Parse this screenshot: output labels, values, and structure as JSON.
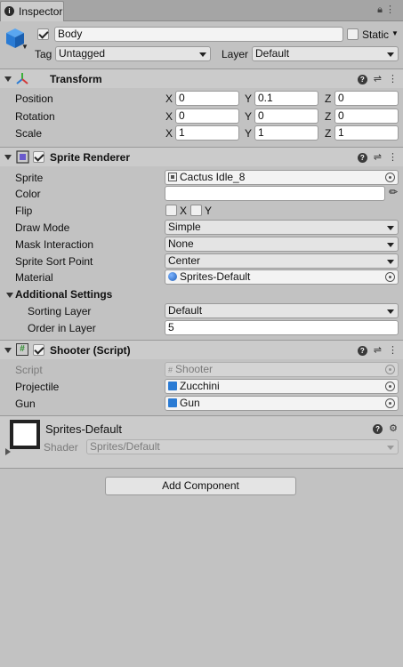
{
  "tab": {
    "title": "Inspector",
    "lock_icon": "lock-icon",
    "menu_icon": "kebab-icon"
  },
  "gameobject": {
    "name": "Body",
    "active": true,
    "static_label": "Static",
    "static": false,
    "tag_label": "Tag",
    "tag_value": "Untagged",
    "layer_label": "Layer",
    "layer_value": "Default"
  },
  "transform": {
    "title": "Transform",
    "rows": [
      {
        "label": "Position",
        "x": "0",
        "y": "0.1",
        "z": "0"
      },
      {
        "label": "Rotation",
        "x": "0",
        "y": "0",
        "z": "0"
      },
      {
        "label": "Scale",
        "x": "1",
        "y": "1",
        "z": "1"
      }
    ],
    "axis": {
      "x": "X",
      "y": "Y",
      "z": "Z"
    }
  },
  "sprite_renderer": {
    "title": "Sprite Renderer",
    "enabled": true,
    "sprite_label": "Sprite",
    "sprite_value": "Cactus Idle_8",
    "color_label": "Color",
    "flip_label": "Flip",
    "flip_x": "X",
    "flip_y": "Y",
    "draw_mode_label": "Draw Mode",
    "draw_mode_value": "Simple",
    "mask_label": "Mask Interaction",
    "mask_value": "None",
    "sort_point_label": "Sprite Sort Point",
    "sort_point_value": "Center",
    "material_label": "Material",
    "material_value": "Sprites-Default",
    "additional_label": "Additional Settings",
    "sorting_layer_label": "Sorting Layer",
    "sorting_layer_value": "Default",
    "order_label": "Order in Layer",
    "order_value": "5"
  },
  "shooter": {
    "title": "Shooter (Script)",
    "enabled": true,
    "script_label": "Script",
    "script_value": "Shooter",
    "projectile_label": "Projectile",
    "projectile_value": "Zucchini",
    "gun_label": "Gun",
    "gun_value": "Gun"
  },
  "material": {
    "name": "Sprites-Default",
    "shader_label": "Shader",
    "shader_value": "Sprites/Default"
  },
  "add_component_label": "Add Component",
  "colors": {
    "background": "#c2c2c2",
    "header": "#cbcbcb",
    "accent_blue": "#2a7bd4"
  }
}
